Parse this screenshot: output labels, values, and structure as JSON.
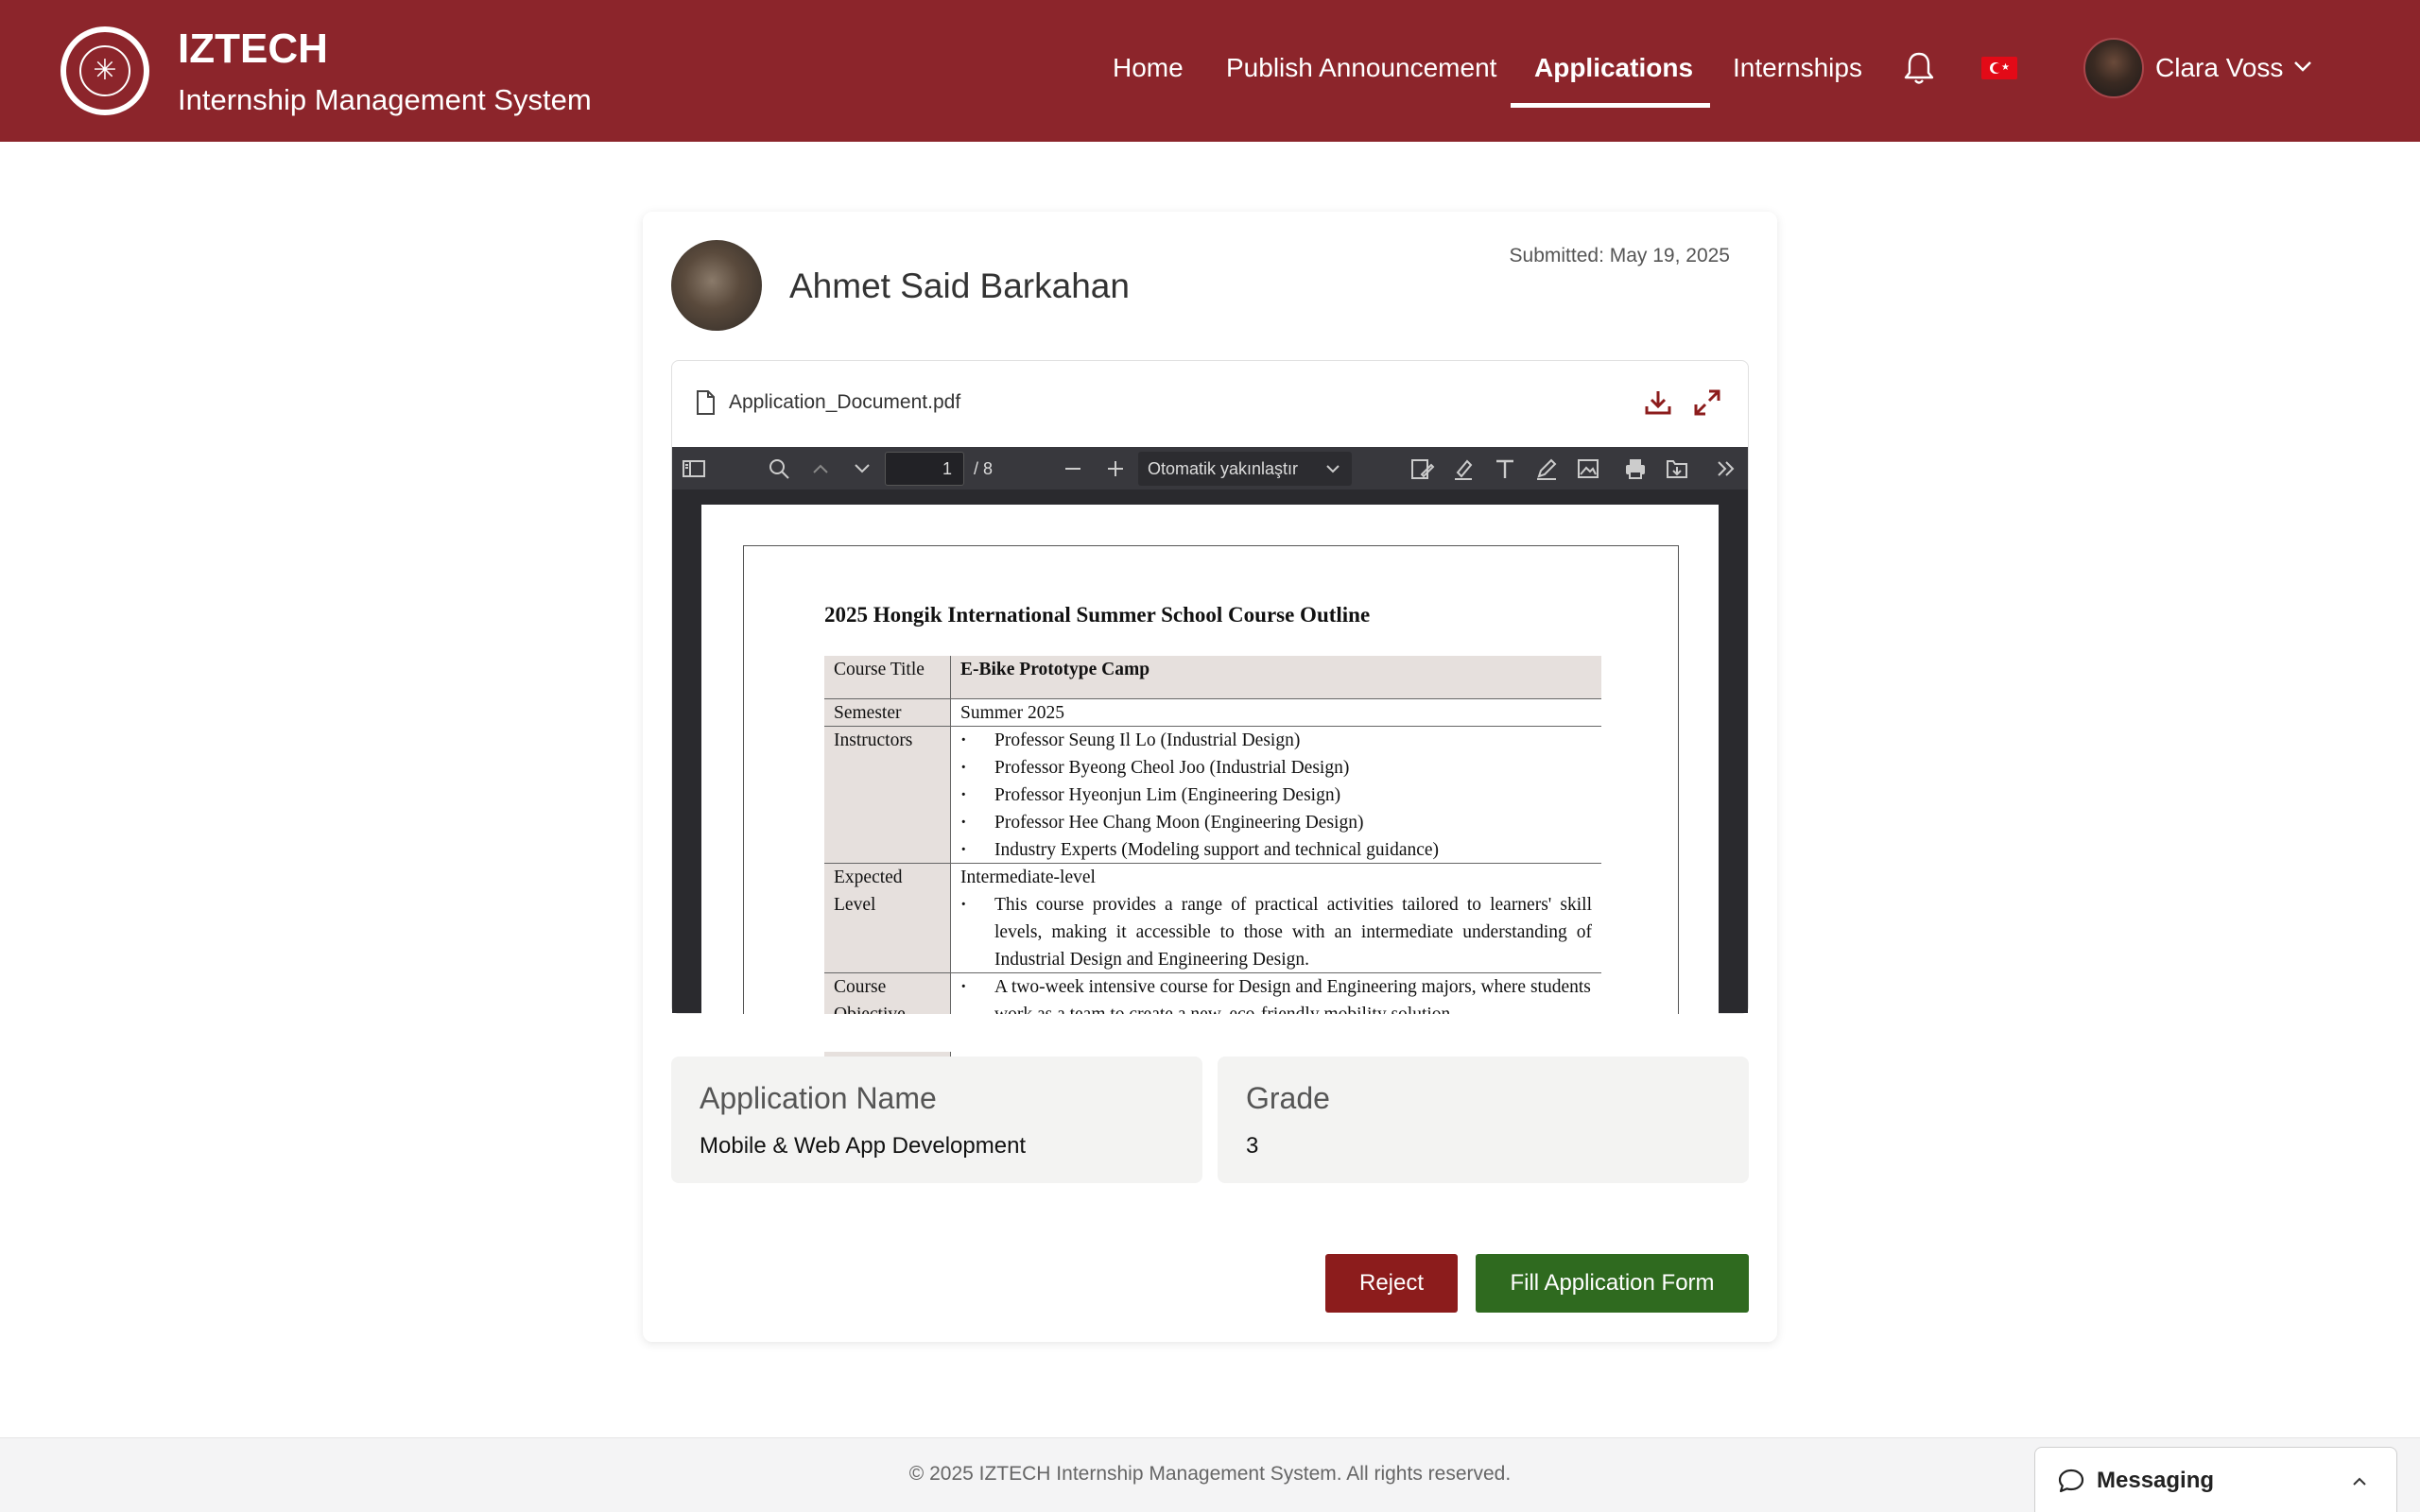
{
  "header": {
    "brand_title": "IZTECH",
    "brand_subtitle": "Internship Management System",
    "nav": [
      "Home",
      "Publish Announcement",
      "Applications",
      "Internships"
    ],
    "active_nav": "Applications",
    "language_flag": "turkey-flag-icon",
    "user_name": "Clara Voss",
    "bg_color": "#8c252b"
  },
  "applicant": {
    "name": "Ahmet Said Barkahan",
    "submitted": "Submitted: May 19, 2025"
  },
  "document": {
    "file_name": "Application_Document.pdf",
    "viewer": {
      "page_current": "1",
      "page_total": "/ 8",
      "zoom": "Otomatik yakınlaştır"
    },
    "content": {
      "title": "2025 Hongik International Summer School Course Outline",
      "rows": {
        "course_title_label": "Course Title",
        "course_title_value": "E-Bike Prototype Camp",
        "semester_label": "Semester",
        "semester_value": "Summer 2025",
        "instructors_label": "Instructors",
        "instructors": [
          "Professor Seung Il Lo (Industrial Design)",
          "Professor Byeong Cheol Joo (Industrial Design)",
          "Professor Hyeonjun Lim (Engineering Design)",
          "Professor Hee Chang Moon (Engineering Design)",
          "Industry Experts (Modeling support and technical guidance)"
        ],
        "level_label_1": "Expected",
        "level_label_2": "Level",
        "level_value": "Intermediate-level",
        "level_bullet": "This course provides a range of practical activities tailored to learners' skill levels, making it accessible to those with an intermediate understanding of Industrial Design and Engineering Design.",
        "objective_label_1": "Course",
        "objective_label_2": "Objective",
        "objective_bullet": "A two-week intensive course for Design and Engineering majors, where students work as a team to create a new, eco-friendly mobility solution."
      }
    }
  },
  "details": {
    "application_name_label": "Application Name",
    "application_name_value": "Mobile & Web App Development",
    "grade_label": "Grade",
    "grade_value": "3"
  },
  "actions": {
    "reject": "Reject",
    "fill": "Fill Application Form",
    "reject_color": "#8c1c1c",
    "fill_color": "#2f6a1f"
  },
  "footer": {
    "copyright": "© 2025 IZTECH Internship Management System. All rights reserved.",
    "messaging": "Messaging"
  }
}
